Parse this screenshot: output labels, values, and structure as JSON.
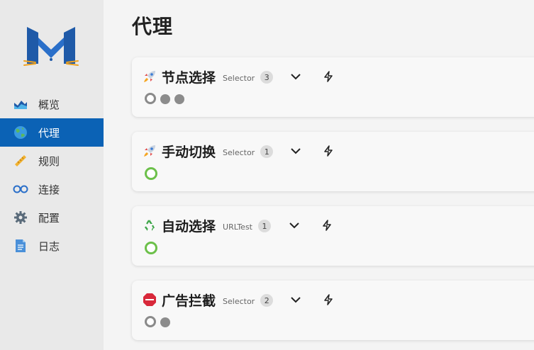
{
  "sidebar": {
    "items": [
      {
        "label": "概览",
        "icon": "chart-icon",
        "active": false
      },
      {
        "label": "代理",
        "icon": "globe-icon",
        "active": true
      },
      {
        "label": "规则",
        "icon": "ruler-icon",
        "active": false
      },
      {
        "label": "连接",
        "icon": "link-icon",
        "active": false
      },
      {
        "label": "配置",
        "icon": "gear-icon",
        "active": false
      },
      {
        "label": "日志",
        "icon": "document-icon",
        "active": false
      }
    ]
  },
  "main": {
    "title": "代理",
    "groups": [
      {
        "emoji": "rocket",
        "name": "节点选择",
        "type": "Selector",
        "count": "3",
        "proxies": [
          "selected",
          "latency",
          "latency"
        ]
      },
      {
        "emoji": "rocket",
        "name": "手动切换",
        "type": "Selector",
        "count": "1",
        "proxies": [
          "selected-ok"
        ]
      },
      {
        "emoji": "recycle",
        "name": "自动选择",
        "type": "URLTest",
        "count": "1",
        "proxies": [
          "selected-ok"
        ]
      },
      {
        "emoji": "stop-sign",
        "name": "广告拦截",
        "type": "Selector",
        "count": "2",
        "proxies": [
          "selected",
          "latency"
        ]
      }
    ]
  },
  "colors": {
    "accent": "#0b62b5",
    "ok": "#6cc04a",
    "idle": "#8c8c8c"
  }
}
